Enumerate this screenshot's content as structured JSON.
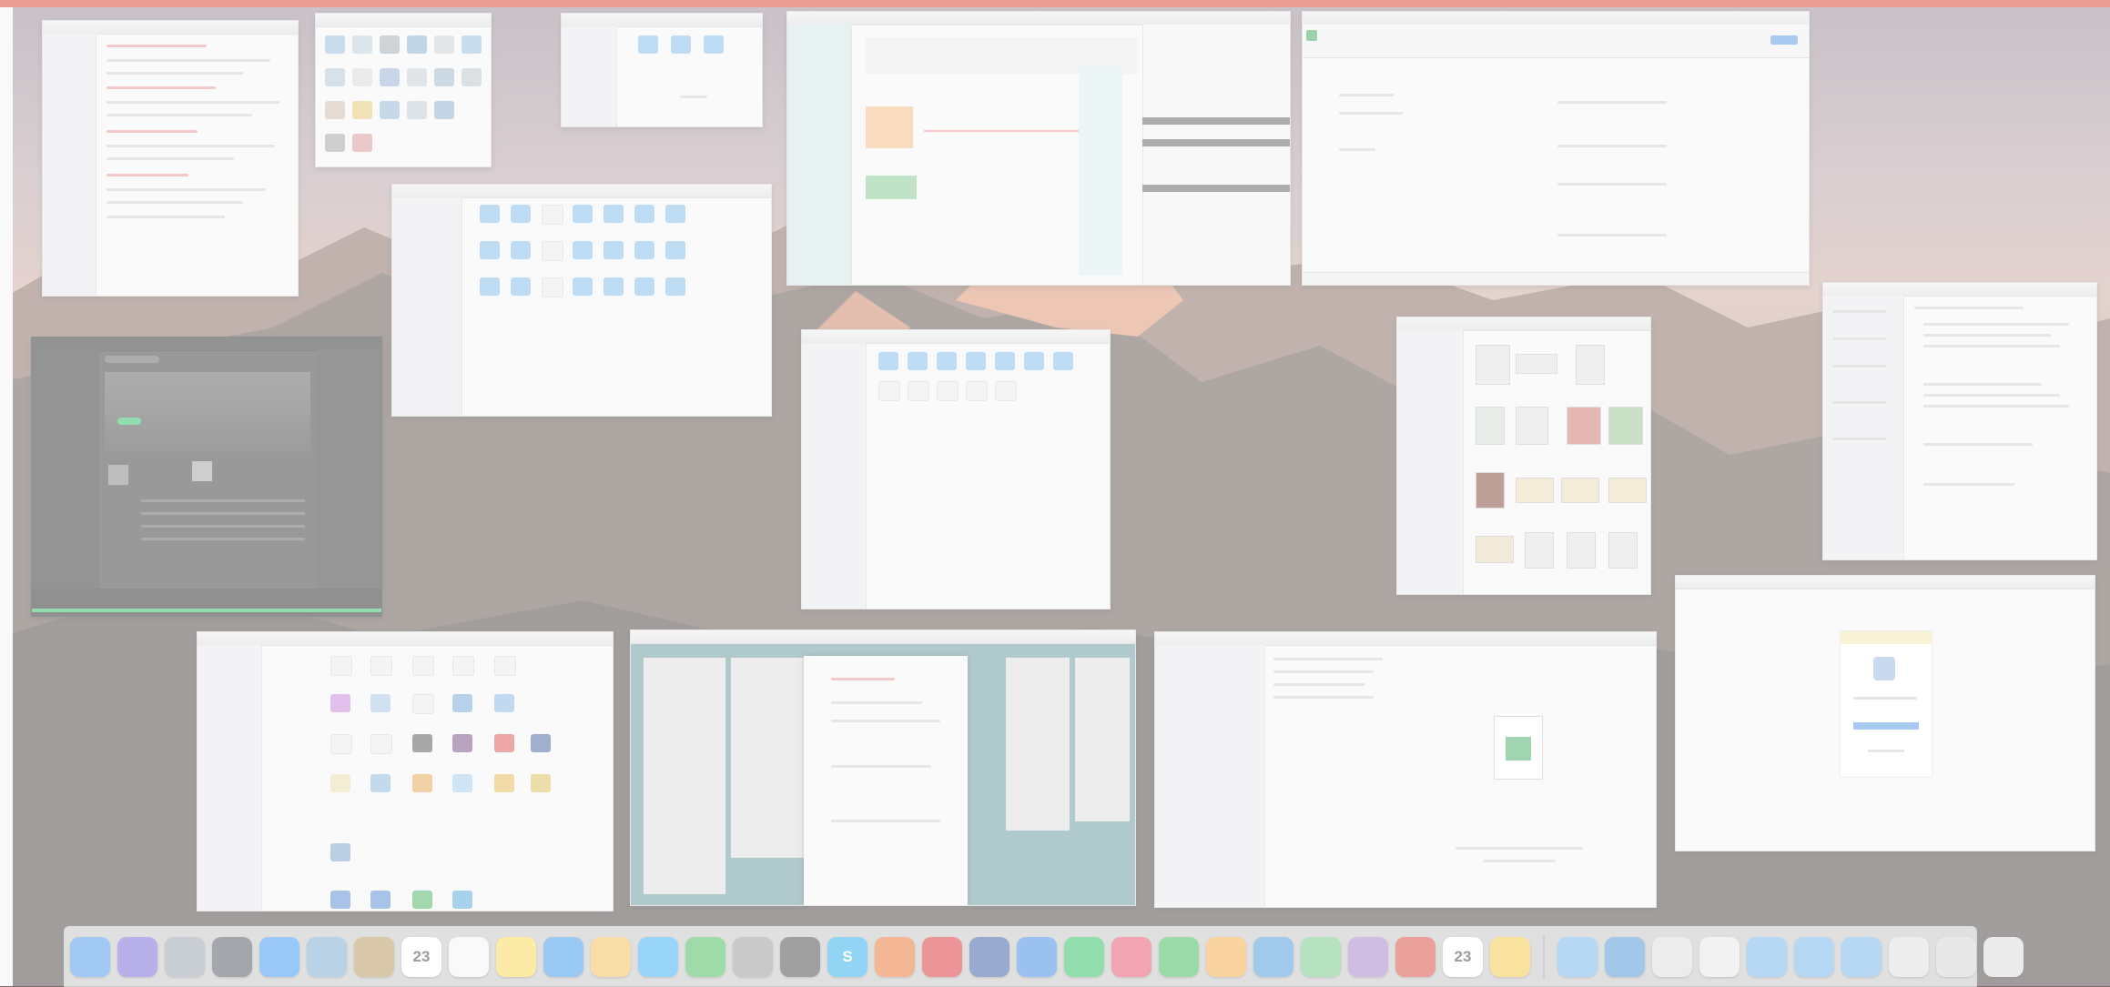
{
  "desktop": {
    "accent_color": "#d2341f"
  },
  "windows": [
    {
      "id": "notes",
      "app": "notes-window"
    },
    {
      "id": "launchpad",
      "app": "app-icon-grid-window"
    },
    {
      "id": "small-finder",
      "app": "finder-window"
    },
    {
      "id": "calendar",
      "app": "calendar-window"
    },
    {
      "id": "spreadsheet",
      "app": "spreadsheet-window"
    },
    {
      "id": "spotify",
      "app": "music-player-window"
    },
    {
      "id": "finder-main",
      "app": "finder-window"
    },
    {
      "id": "finder-center",
      "app": "finder-window"
    },
    {
      "id": "finder-photos",
      "app": "finder-window"
    },
    {
      "id": "document",
      "app": "text-document-window"
    },
    {
      "id": "finder-apps",
      "app": "finder-window"
    },
    {
      "id": "trello",
      "app": "board-window"
    },
    {
      "id": "sheets-preview",
      "app": "file-preview-window"
    },
    {
      "id": "dialog",
      "app": "dialog-window"
    }
  ],
  "dock": {
    "apps": [
      {
        "name": "finder-icon",
        "color": "#3b8ee8",
        "label": ""
      },
      {
        "name": "siri-icon",
        "color": "#6b5bd6",
        "label": ""
      },
      {
        "name": "launchpad-icon",
        "color": "#8d9aa6",
        "label": ""
      },
      {
        "name": "mission-control-icon",
        "color": "#404850",
        "label": ""
      },
      {
        "name": "app-store-icon",
        "color": "#2b8df0",
        "label": ""
      },
      {
        "name": "preview-icon",
        "color": "#6fa1c9",
        "label": ""
      },
      {
        "name": "notebook-icon",
        "color": "#b08a4c",
        "label": ""
      },
      {
        "name": "calendar-icon",
        "color": "#ffffff",
        "label": "23"
      },
      {
        "name": "reminders-icon",
        "color": "#f2f2f2",
        "label": ""
      },
      {
        "name": "notes-icon",
        "color": "#f7d548",
        "label": ""
      },
      {
        "name": "safari-icon",
        "color": "#2c8fe6",
        "label": ""
      },
      {
        "name": "photos-icon",
        "color": "#f2b84b",
        "label": ""
      },
      {
        "name": "messages-icon",
        "color": "#2aa6f2",
        "label": ""
      },
      {
        "name": "facetime-icon",
        "color": "#36b34a",
        "label": ""
      },
      {
        "name": "system-preferences-icon",
        "color": "#8e8e8e",
        "label": ""
      },
      {
        "name": "obs-icon",
        "color": "#3a3a3a",
        "label": ""
      },
      {
        "name": "skype-icon",
        "color": "#1ca6e6",
        "label": "S"
      },
      {
        "name": "firefox-icon",
        "color": "#e96a22",
        "label": ""
      },
      {
        "name": "opera-icon",
        "color": "#d5232b",
        "label": ""
      },
      {
        "name": "flipboard-icon",
        "color": "#2a4f9c",
        "label": ""
      },
      {
        "name": "intercom-icon",
        "color": "#2f7de0",
        "label": ""
      },
      {
        "name": "spotify-icon",
        "color": "#1db954",
        "label": ""
      },
      {
        "name": "lips-icon",
        "color": "#e2415f",
        "label": ""
      },
      {
        "name": "evernote-icon",
        "color": "#2fb24c",
        "label": ""
      },
      {
        "name": "pages-icon",
        "color": "#f4a63a",
        "label": ""
      },
      {
        "name": "keynote-icon",
        "color": "#3a8fd8",
        "label": ""
      },
      {
        "name": "maps-icon",
        "color": "#6ac27a",
        "label": ""
      },
      {
        "name": "notebooks-icon",
        "color": "#9a78c7",
        "label": ""
      },
      {
        "name": "scrivener-icon",
        "color": "#d23b2c",
        "label": ""
      },
      {
        "name": "calendar-2-icon",
        "color": "#ffffff",
        "label": "23"
      },
      {
        "name": "chrome-icon",
        "color": "#f2c23a",
        "label": ""
      }
    ],
    "stacks": [
      {
        "name": "folder-stack-icon",
        "color": "#68aee9"
      },
      {
        "name": "globe-icon",
        "color": "#3e8ad2"
      },
      {
        "name": "document-stack-icon",
        "color": "#d8d8d8"
      },
      {
        "name": "pdf-stack-icon",
        "color": "#e4e4e4"
      },
      {
        "name": "downloads-folder-icon",
        "color": "#68aee9"
      },
      {
        "name": "documents-folder-icon",
        "color": "#68aee9"
      },
      {
        "name": "desktop-folder-icon",
        "color": "#68aee9"
      },
      {
        "name": "files-stack-icon",
        "color": "#d9d9d9"
      },
      {
        "name": "mail-stack-icon",
        "color": "#cfcfcf"
      },
      {
        "name": "trash-icon",
        "color": "#d5d5d5"
      }
    ]
  }
}
